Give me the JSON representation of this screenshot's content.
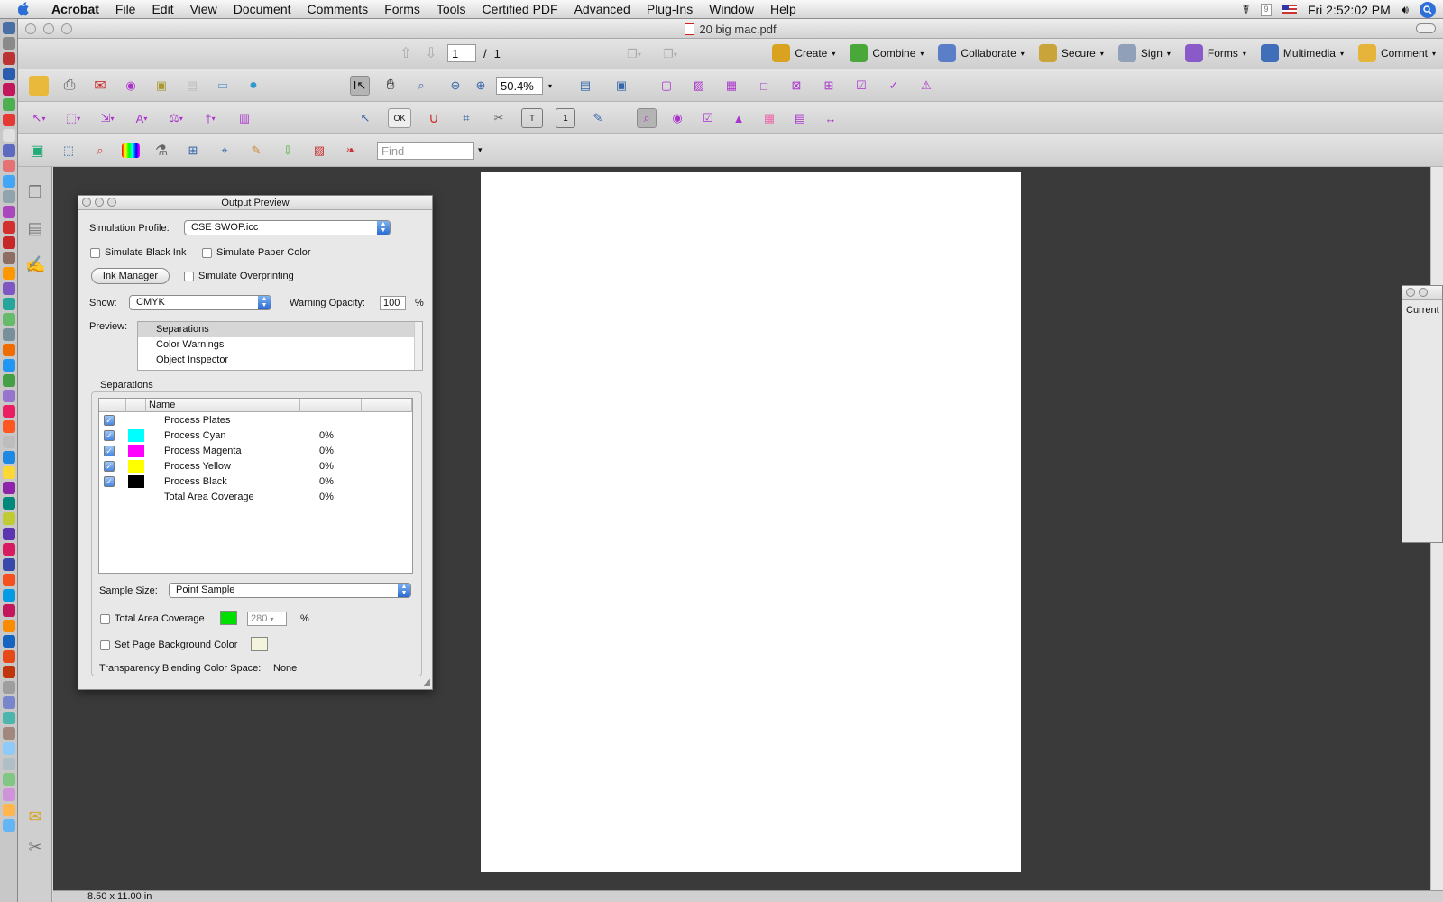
{
  "menubar": {
    "app": "Acrobat",
    "items": [
      "File",
      "Edit",
      "View",
      "Document",
      "Comments",
      "Forms",
      "Tools",
      "Certified PDF",
      "Advanced",
      "Plug-Ins",
      "Window",
      "Help"
    ],
    "clock": "Fri 2:52:02 PM"
  },
  "window": {
    "title": "20 big mac.pdf"
  },
  "nav": {
    "page_value": "1",
    "page_sep": "/",
    "page_total": "1"
  },
  "tasks": [
    {
      "label": "Create",
      "color": "#d9a21f"
    },
    {
      "label": "Combine",
      "color": "#4aa83a"
    },
    {
      "label": "Collaborate",
      "color": "#5a7fc7"
    },
    {
      "label": "Secure",
      "color": "#c9a43a"
    },
    {
      "label": "Sign",
      "color": "#8fa0b8"
    },
    {
      "label": "Forms",
      "color": "#8a5ac8"
    },
    {
      "label": "Multimedia",
      "color": "#3f6fb8"
    },
    {
      "label": "Comment",
      "color": "#e6b43a"
    }
  ],
  "toolbar": {
    "zoom": "50.4%",
    "find_placeholder": "Find"
  },
  "status": {
    "page_size": "8.50 x 11.00 in"
  },
  "side_palette": {
    "title": "Current"
  },
  "output_preview": {
    "title": "Output Preview",
    "simulation_profile_label": "Simulation Profile:",
    "simulation_profile_value": "CSE SWOP.icc",
    "simulate_black_ink": "Simulate Black Ink",
    "simulate_paper_color": "Simulate Paper Color",
    "ink_manager": "Ink Manager",
    "simulate_overprinting": "Simulate Overprinting",
    "show_label": "Show:",
    "show_value": "CMYK",
    "warning_opacity_label": "Warning Opacity:",
    "warning_opacity_value": "100",
    "percent": "%",
    "preview_label": "Preview:",
    "preview_options": [
      "Separations",
      "Color Warnings",
      "Object Inspector"
    ],
    "separations_label": "Separations",
    "column_name": "Name",
    "separations": [
      {
        "name": "Process Plates",
        "checked": true,
        "color": "",
        "pct": ""
      },
      {
        "name": "Process Cyan",
        "checked": true,
        "color": "#00ffff",
        "pct": "0%"
      },
      {
        "name": "Process Magenta",
        "checked": true,
        "color": "#ff00ff",
        "pct": "0%"
      },
      {
        "name": "Process Yellow",
        "checked": true,
        "color": "#ffff00",
        "pct": "0%"
      },
      {
        "name": "Process Black",
        "checked": true,
        "color": "#000000",
        "pct": "0%"
      },
      {
        "name": "Total Area Coverage",
        "checked": false,
        "color": "",
        "pct": "0%"
      }
    ],
    "sample_size_label": "Sample Size:",
    "sample_size_value": "Point Sample",
    "total_area_coverage_label": "Total Area Coverage",
    "tac_color": "#00e000",
    "tac_value": "280",
    "set_page_bg_label": "Set Page Background Color",
    "bg_color": "#f4f4dc",
    "blend_space_label": "Transparency Blending Color Space:",
    "blend_space_value": "None"
  }
}
